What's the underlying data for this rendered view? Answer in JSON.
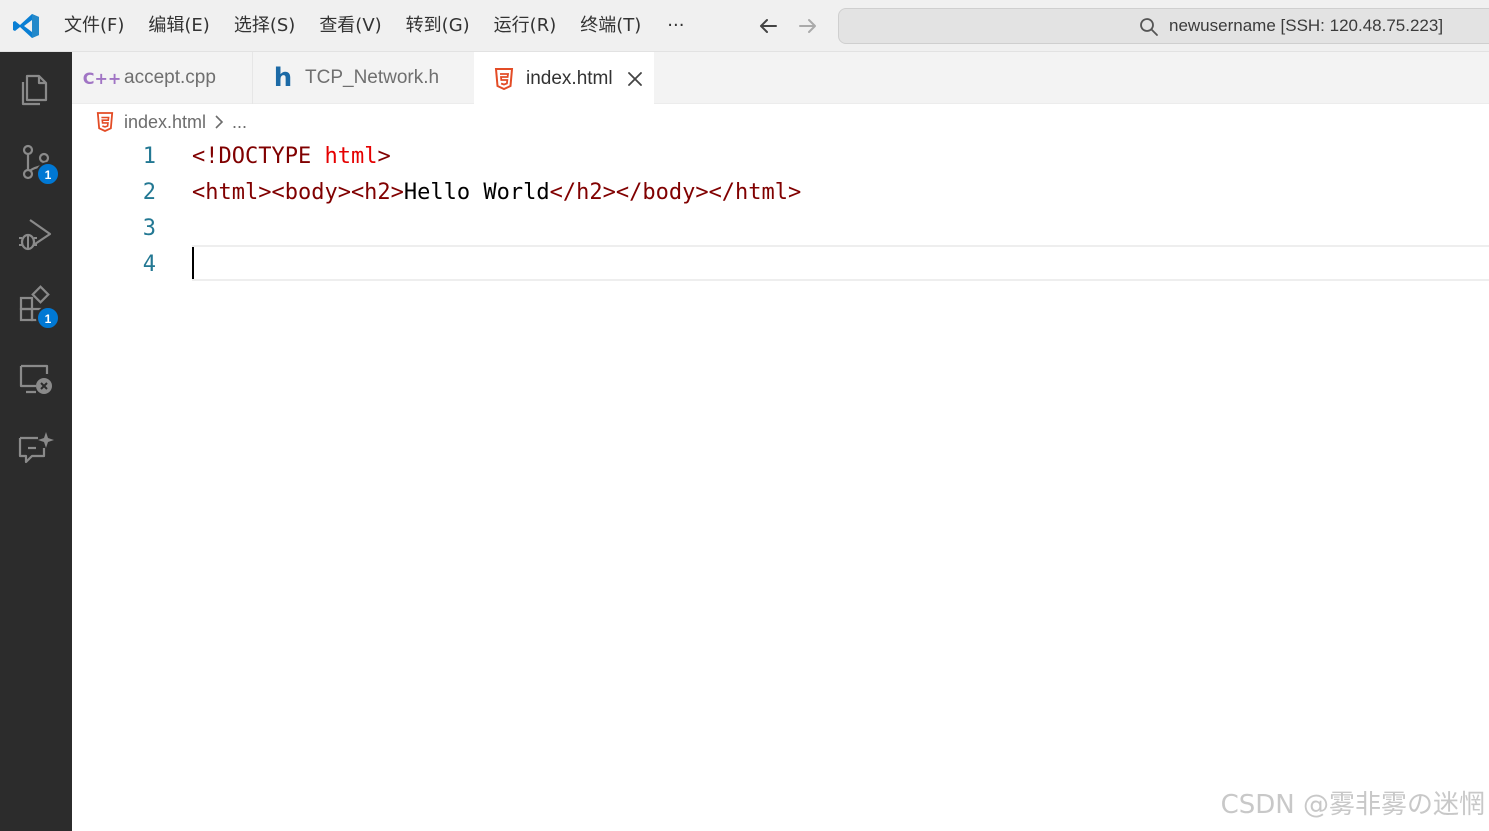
{
  "titlebar": {
    "menu": [
      "文件(F)",
      "编辑(E)",
      "选择(S)",
      "查看(V)",
      "转到(G)",
      "运行(R)",
      "终端(T)"
    ],
    "more": "···",
    "search_text": "newusername [SSH: 120.48.75.223]"
  },
  "activitybar": {
    "items": [
      {
        "name": "explorer-icon"
      },
      {
        "name": "source-control-icon",
        "badge": "1"
      },
      {
        "name": "run-debug-icon"
      },
      {
        "name": "extensions-icon",
        "badge": "1"
      },
      {
        "name": "remote-explorer-icon"
      },
      {
        "name": "chat-icon"
      }
    ]
  },
  "tabs": [
    {
      "icon_text": "C++",
      "label": "accept.cpp",
      "active": false
    },
    {
      "icon_text": "h",
      "label": "TCP_Network.h",
      "active": false
    },
    {
      "icon_text": "html5",
      "label": "index.html",
      "active": true
    }
  ],
  "breadcrumb": {
    "file": "index.html",
    "more": "..."
  },
  "editor": {
    "lines": [
      {
        "num": "1",
        "tokens": [
          {
            "t": "<!DOCTYPE ",
            "c": "kw"
          },
          {
            "t": "html",
            "c": "name"
          },
          {
            "t": ">",
            "c": "kw"
          }
        ]
      },
      {
        "num": "2",
        "tokens": [
          {
            "t": "<html><body><h2>",
            "c": "tag"
          },
          {
            "t": "Hello World",
            "c": "text"
          },
          {
            "t": "</h2></body></html>",
            "c": "tag"
          }
        ]
      },
      {
        "num": "3",
        "tokens": []
      },
      {
        "num": "4",
        "tokens": []
      }
    ]
  },
  "colors": {
    "accent": "#0078d4",
    "tag": "#800000",
    "attr_name": "#e50000",
    "line_number": "#237893",
    "html_icon": "#e34c26"
  },
  "watermark": "CSDN @雾非雾の迷惘"
}
